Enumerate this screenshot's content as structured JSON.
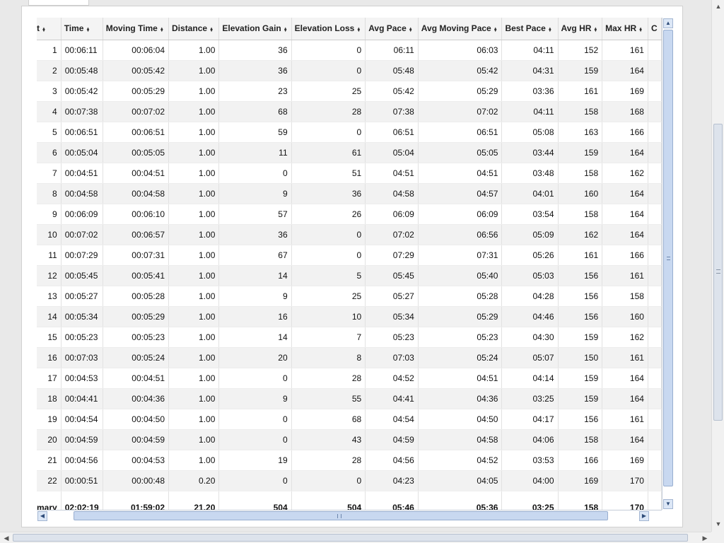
{
  "table": {
    "columns": [
      {
        "label": "t",
        "key": "lap"
      },
      {
        "label": "Time",
        "key": "time"
      },
      {
        "label": "Moving Time",
        "key": "moving_time"
      },
      {
        "label": "Distance",
        "key": "distance"
      },
      {
        "label": "Elevation Gain",
        "key": "elev_gain"
      },
      {
        "label": "Elevation Loss",
        "key": "elev_loss"
      },
      {
        "label": "Avg Pace",
        "key": "avg_pace"
      },
      {
        "label": "Avg Moving Pace",
        "key": "avg_moving_pace"
      },
      {
        "label": "Best Pace",
        "key": "best_pace"
      },
      {
        "label": "Avg HR",
        "key": "avg_hr"
      },
      {
        "label": "Max HR",
        "key": "max_hr"
      },
      {
        "label": "C",
        "key": "next"
      }
    ],
    "rows": [
      [
        "1",
        "00:06:11",
        "00:06:04",
        "1.00",
        "36",
        "0",
        "06:11",
        "06:03",
        "04:11",
        "152",
        "161",
        ""
      ],
      [
        "2",
        "00:05:48",
        "00:05:42",
        "1.00",
        "36",
        "0",
        "05:48",
        "05:42",
        "04:31",
        "159",
        "164",
        ""
      ],
      [
        "3",
        "00:05:42",
        "00:05:29",
        "1.00",
        "23",
        "25",
        "05:42",
        "05:29",
        "03:36",
        "161",
        "169",
        ""
      ],
      [
        "4",
        "00:07:38",
        "00:07:02",
        "1.00",
        "68",
        "28",
        "07:38",
        "07:02",
        "04:11",
        "158",
        "168",
        ""
      ],
      [
        "5",
        "00:06:51",
        "00:06:51",
        "1.00",
        "59",
        "0",
        "06:51",
        "06:51",
        "05:08",
        "163",
        "166",
        ""
      ],
      [
        "6",
        "00:05:04",
        "00:05:05",
        "1.00",
        "11",
        "61",
        "05:04",
        "05:05",
        "03:44",
        "159",
        "164",
        ""
      ],
      [
        "7",
        "00:04:51",
        "00:04:51",
        "1.00",
        "0",
        "51",
        "04:51",
        "04:51",
        "03:48",
        "158",
        "162",
        ""
      ],
      [
        "8",
        "00:04:58",
        "00:04:58",
        "1.00",
        "9",
        "36",
        "04:58",
        "04:57",
        "04:01",
        "160",
        "164",
        ""
      ],
      [
        "9",
        "00:06:09",
        "00:06:10",
        "1.00",
        "57",
        "26",
        "06:09",
        "06:09",
        "03:54",
        "158",
        "164",
        ""
      ],
      [
        "10",
        "00:07:02",
        "00:06:57",
        "1.00",
        "36",
        "0",
        "07:02",
        "06:56",
        "05:09",
        "162",
        "164",
        ""
      ],
      [
        "11",
        "00:07:29",
        "00:07:31",
        "1.00",
        "67",
        "0",
        "07:29",
        "07:31",
        "05:26",
        "161",
        "166",
        ""
      ],
      [
        "12",
        "00:05:45",
        "00:05:41",
        "1.00",
        "14",
        "5",
        "05:45",
        "05:40",
        "05:03",
        "156",
        "161",
        ""
      ],
      [
        "13",
        "00:05:27",
        "00:05:28",
        "1.00",
        "9",
        "25",
        "05:27",
        "05:28",
        "04:28",
        "156",
        "158",
        ""
      ],
      [
        "14",
        "00:05:34",
        "00:05:29",
        "1.00",
        "16",
        "10",
        "05:34",
        "05:29",
        "04:46",
        "156",
        "160",
        ""
      ],
      [
        "15",
        "00:05:23",
        "00:05:23",
        "1.00",
        "14",
        "7",
        "05:23",
        "05:23",
        "04:30",
        "159",
        "162",
        ""
      ],
      [
        "16",
        "00:07:03",
        "00:05:24",
        "1.00",
        "20",
        "8",
        "07:03",
        "05:24",
        "05:07",
        "150",
        "161",
        ""
      ],
      [
        "17",
        "00:04:53",
        "00:04:51",
        "1.00",
        "0",
        "28",
        "04:52",
        "04:51",
        "04:14",
        "159",
        "164",
        ""
      ],
      [
        "18",
        "00:04:41",
        "00:04:36",
        "1.00",
        "9",
        "55",
        "04:41",
        "04:36",
        "03:25",
        "159",
        "164",
        ""
      ],
      [
        "19",
        "00:04:54",
        "00:04:50",
        "1.00",
        "0",
        "68",
        "04:54",
        "04:50",
        "04:17",
        "156",
        "161",
        ""
      ],
      [
        "20",
        "00:04:59",
        "00:04:59",
        "1.00",
        "0",
        "43",
        "04:59",
        "04:58",
        "04:06",
        "158",
        "164",
        ""
      ],
      [
        "21",
        "00:04:56",
        "00:04:53",
        "1.00",
        "19",
        "28",
        "04:56",
        "04:52",
        "03:53",
        "166",
        "169",
        ""
      ],
      [
        "22",
        "00:00:51",
        "00:00:48",
        "0.20",
        "0",
        "0",
        "04:23",
        "04:05",
        "04:00",
        "169",
        "170",
        ""
      ]
    ],
    "summary": [
      "mary",
      "02:02:19",
      "01:59:02",
      "21.20",
      "504",
      "504",
      "05:46",
      "05:36",
      "03:25",
      "158",
      "170",
      ""
    ]
  },
  "icons": {
    "sort": "sort-arrows-icon",
    "scroll_up": "chevron-up-icon",
    "scroll_down": "chevron-down-icon",
    "scroll_left": "chevron-left-icon",
    "scroll_right": "chevron-right-icon"
  },
  "colors": {
    "header_bg": "#f4f4f4",
    "alt_row_bg": "#f2f2f2",
    "scroll_thumb": "#c8d8f0"
  }
}
